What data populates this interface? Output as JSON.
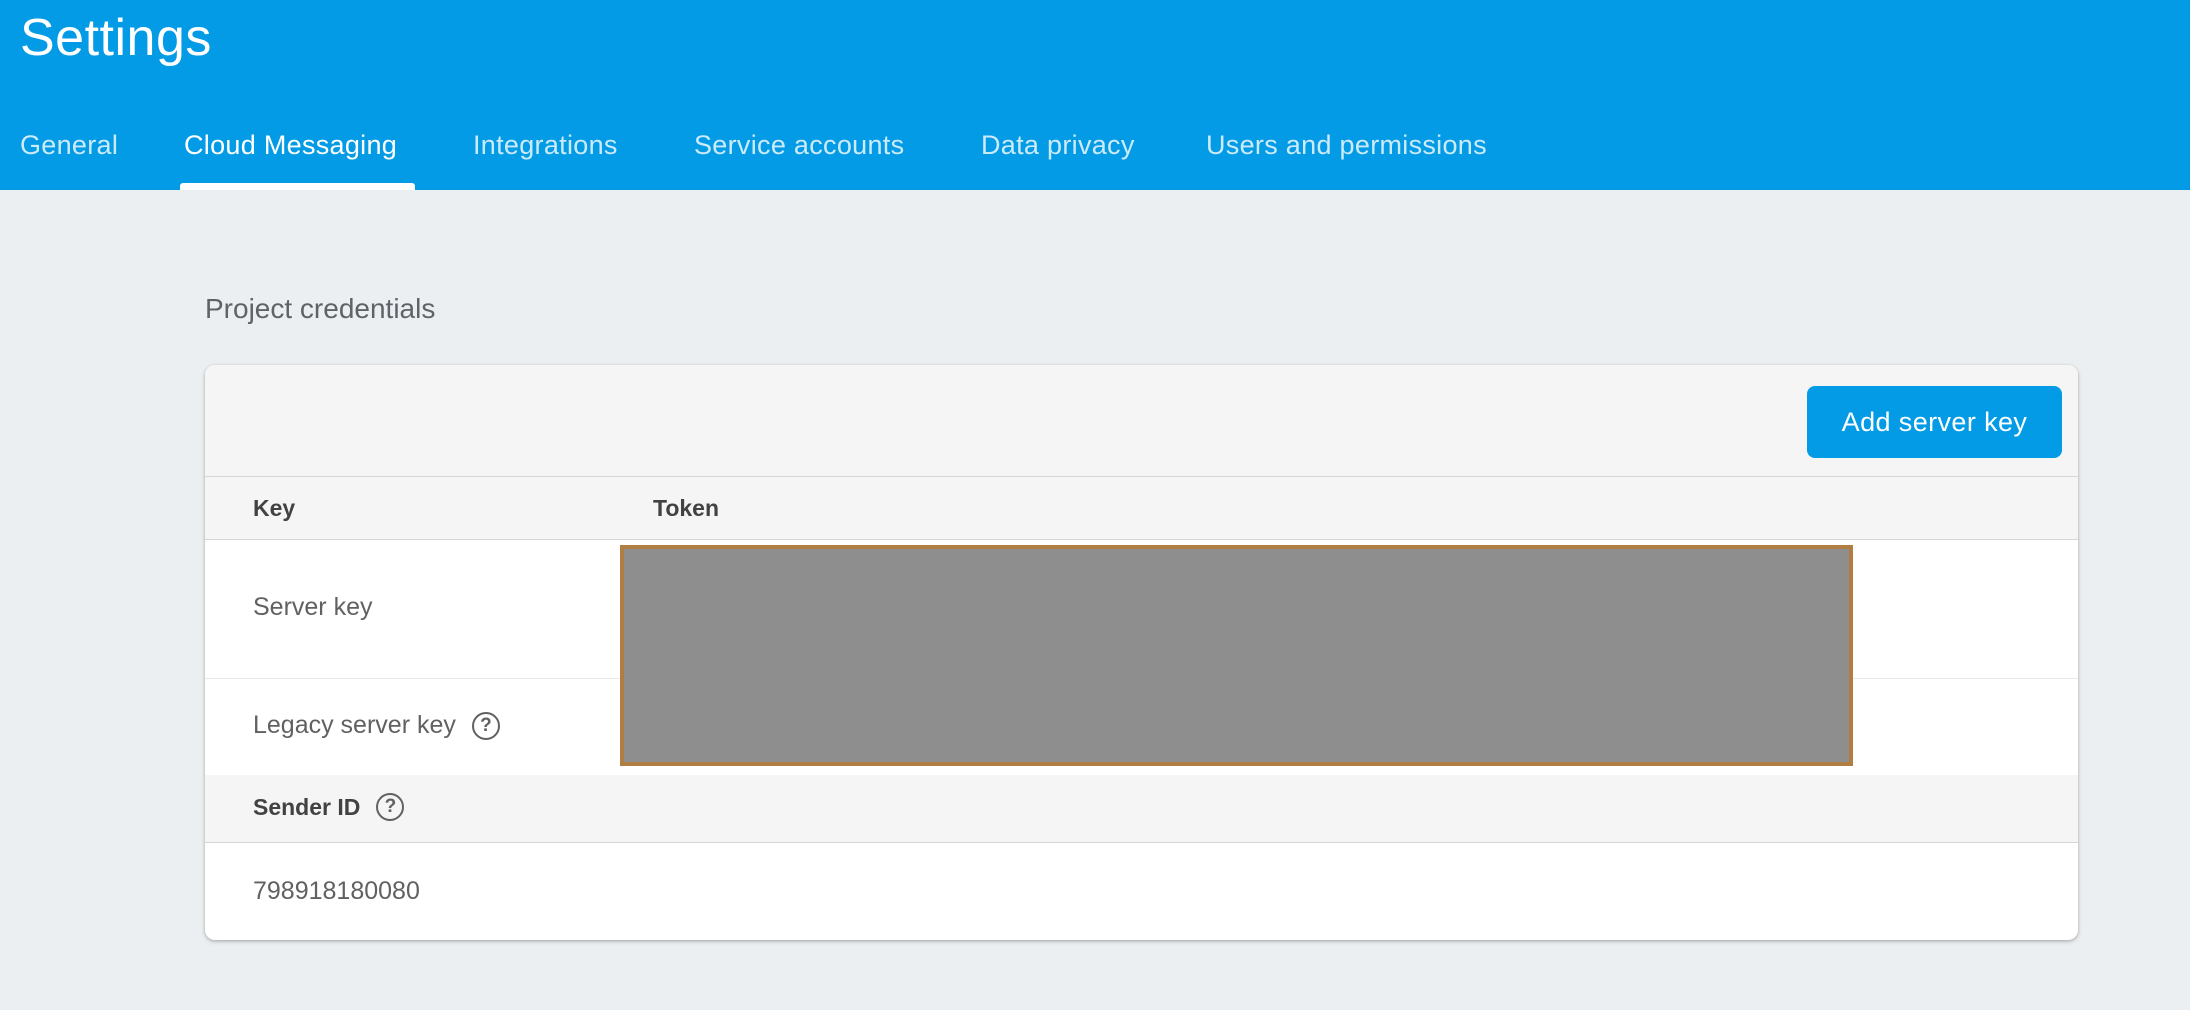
{
  "header": {
    "title": "Settings",
    "tabs": [
      {
        "label": "General"
      },
      {
        "label": "Cloud Messaging"
      },
      {
        "label": "Integrations"
      },
      {
        "label": "Service accounts"
      },
      {
        "label": "Data privacy"
      },
      {
        "label": "Users and permissions"
      }
    ],
    "active_tab": "Cloud Messaging"
  },
  "main": {
    "section_title": "Project credentials",
    "add_server_key_label": "Add server key",
    "table": {
      "columns": [
        "Key",
        "Token"
      ],
      "rows": [
        {
          "key": "Server key",
          "token": "",
          "has_help": false
        },
        {
          "key": "Legacy server key",
          "token": "",
          "has_help": true
        }
      ]
    },
    "sender": {
      "label": "Sender ID",
      "value": "798918180080"
    }
  },
  "colors": {
    "header_bg": "#039be5",
    "page_bg": "#eceff1",
    "button_bg": "#039be5",
    "redaction_fill": "#8e8e8e",
    "redaction_border": "#b07d43"
  },
  "icons": {
    "help": "help-circle-icon"
  }
}
